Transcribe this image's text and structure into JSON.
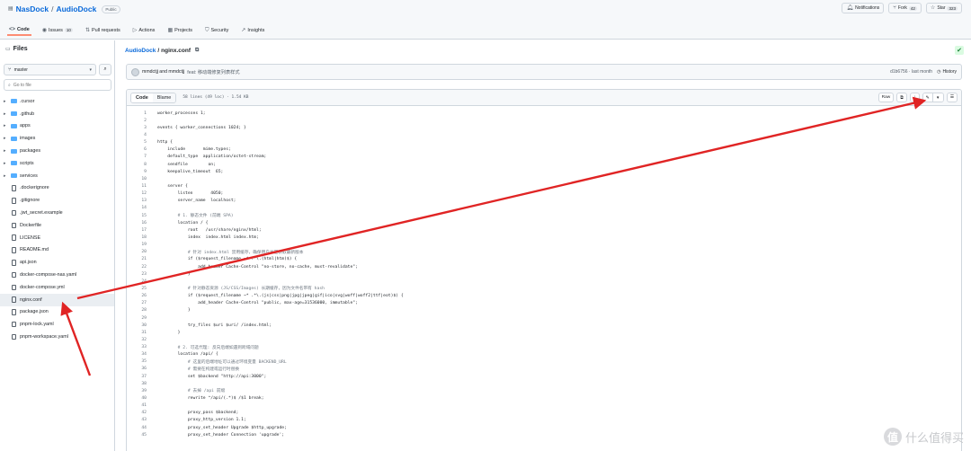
{
  "repo": {
    "owner": "NasDock",
    "sep": "/",
    "name": "AudioDock",
    "visibility": "Public"
  },
  "actions": {
    "notifications": "Notifications",
    "fork": "Fork",
    "fork_count": "42",
    "star": "Star",
    "star_count": "323"
  },
  "tabs": [
    {
      "label": "Code",
      "icon": "code-icon"
    },
    {
      "label": "Issues",
      "count": "10",
      "icon": "issue-icon"
    },
    {
      "label": "Pull requests",
      "icon": "pull-request-icon"
    },
    {
      "label": "Actions",
      "icon": "play-icon"
    },
    {
      "label": "Projects",
      "icon": "table-icon"
    },
    {
      "label": "Security",
      "icon": "shield-icon"
    },
    {
      "label": "Insights",
      "icon": "graph-icon"
    }
  ],
  "sidebar": {
    "title": "Files",
    "branch": "master",
    "goto_placeholder": "Go to file",
    "items": [
      {
        "label": ".cursor",
        "type": "folder"
      },
      {
        "label": ".github",
        "type": "folder"
      },
      {
        "label": "apps",
        "type": "folder"
      },
      {
        "label": "images",
        "type": "folder"
      },
      {
        "label": "packages",
        "type": "folder"
      },
      {
        "label": "scripts",
        "type": "folder"
      },
      {
        "label": "services",
        "type": "folder"
      },
      {
        "label": ".dockerignore",
        "type": "file"
      },
      {
        "label": ".gitignore",
        "type": "file"
      },
      {
        "label": ".jwt_secret.example",
        "type": "file"
      },
      {
        "label": "Dockerfile",
        "type": "file"
      },
      {
        "label": "LICENSE",
        "type": "file"
      },
      {
        "label": "README.md",
        "type": "file"
      },
      {
        "label": "api.json",
        "type": "file"
      },
      {
        "label": "docker-compose-nas.yaml",
        "type": "file"
      },
      {
        "label": "docker-compose.yml",
        "type": "file"
      },
      {
        "label": "nginx.conf",
        "type": "file",
        "selected": true
      },
      {
        "label": "package.json",
        "type": "file"
      },
      {
        "label": "pnpm-lock.yaml",
        "type": "file"
      },
      {
        "label": "pnpm-workspace.yaml",
        "type": "file"
      }
    ]
  },
  "breadcrumb": {
    "repo": "AudioDock",
    "sep": "/",
    "file": "nginx.conf"
  },
  "commit": {
    "authors": "mmdctjj and mmdctjj",
    "message": "feat: 移动端修复列表样式",
    "hash": "d1b6756 · last month",
    "history": "History"
  },
  "code": {
    "tab_code": "Code",
    "tab_blame": "Blame",
    "meta": "58 lines (49 loc) · 1.54 KB",
    "raw": "Raw",
    "lines": [
      {
        "n": "1",
        "t": "worker_processes 1;"
      },
      {
        "n": "2",
        "t": ""
      },
      {
        "n": "3",
        "t": "events { worker_connections 1024; }"
      },
      {
        "n": "4",
        "t": ""
      },
      {
        "n": "5",
        "t": "http {"
      },
      {
        "n": "6",
        "t": "    include       mime.types;"
      },
      {
        "n": "7",
        "t": "    default_type  application/octet-stream;"
      },
      {
        "n": "8",
        "t": "    sendfile        on;"
      },
      {
        "n": "9",
        "t": "    keepalive_timeout  65;"
      },
      {
        "n": "10",
        "t": ""
      },
      {
        "n": "11",
        "t": "    server {"
      },
      {
        "n": "12",
        "t": "        listen       4050;"
      },
      {
        "n": "13",
        "t": "        server_name  localhost;"
      },
      {
        "n": "14",
        "t": ""
      },
      {
        "n": "15",
        "t": "        # 1. 静态文件 (前端 SPA)",
        "c": true
      },
      {
        "n": "16",
        "t": "        location / {"
      },
      {
        "n": "17",
        "t": "            root   /usr/share/nginx/html;"
      },
      {
        "n": "18",
        "t": "            index  index.html index.htm;"
      },
      {
        "n": "19",
        "t": ""
      },
      {
        "n": "20",
        "t": "            # 针对 index.html 禁用缓存，确保用户总是获取最新版本",
        "c": true
      },
      {
        "n": "21",
        "t": "            if ($request_filename ~* .*\\.(html|htm)$) {"
      },
      {
        "n": "22",
        "t": "                add_header Cache-Control \"no-store, no-cache, must-revalidate\";"
      },
      {
        "n": "23",
        "t": "            }"
      },
      {
        "n": "24",
        "t": ""
      },
      {
        "n": "25",
        "t": "            # 针对静态资源 (JS/CSS/Images) 长期缓存，因为文件名带有 hash",
        "c": true
      },
      {
        "n": "26",
        "t": "            if ($request_filename ~* .*\\.(js|css|png|jpg|jpeg|gif|ico|svg|woff|woff2|ttf|eot)$) {"
      },
      {
        "n": "27",
        "t": "                add_header Cache-Control \"public, max-age=31536000, immutable\";"
      },
      {
        "n": "28",
        "t": "            }"
      },
      {
        "n": "29",
        "t": ""
      },
      {
        "n": "30",
        "t": "            try_files $uri $uri/ /index.html;"
      },
      {
        "n": "31",
        "t": "        }"
      },
      {
        "n": "32",
        "t": ""
      },
      {
        "n": "33",
        "t": "        # 2. 可选代理: 反向后端如遇到跨域问题",
        "c": true
      },
      {
        "n": "34",
        "t": "        location /api/ {"
      },
      {
        "n": "35",
        "t": "            # 这里的后端地址可以通过环境变量 BACKEND_URL",
        "c": true
      },
      {
        "n": "36",
        "t": "            # 需要在构建或运行时替换",
        "c": true
      },
      {
        "n": "37",
        "t": "            set $backend \"http://api:3000\";"
      },
      {
        "n": "38",
        "t": ""
      },
      {
        "n": "39",
        "t": "            # 去掉 /api 前缀",
        "c": true
      },
      {
        "n": "40",
        "t": "            rewrite ^/api/(.*)$ /$1 break;"
      },
      {
        "n": "41",
        "t": ""
      },
      {
        "n": "42",
        "t": "            proxy_pass $backend;"
      },
      {
        "n": "43",
        "t": "            proxy_http_version 1.1;"
      },
      {
        "n": "44",
        "t": "            proxy_set_header Upgrade $http_upgrade;"
      },
      {
        "n": "45",
        "t": "            proxy_set_header Connection 'upgrade';"
      }
    ]
  },
  "watermark": {
    "glyph": "值",
    "text": "什么值得买"
  }
}
